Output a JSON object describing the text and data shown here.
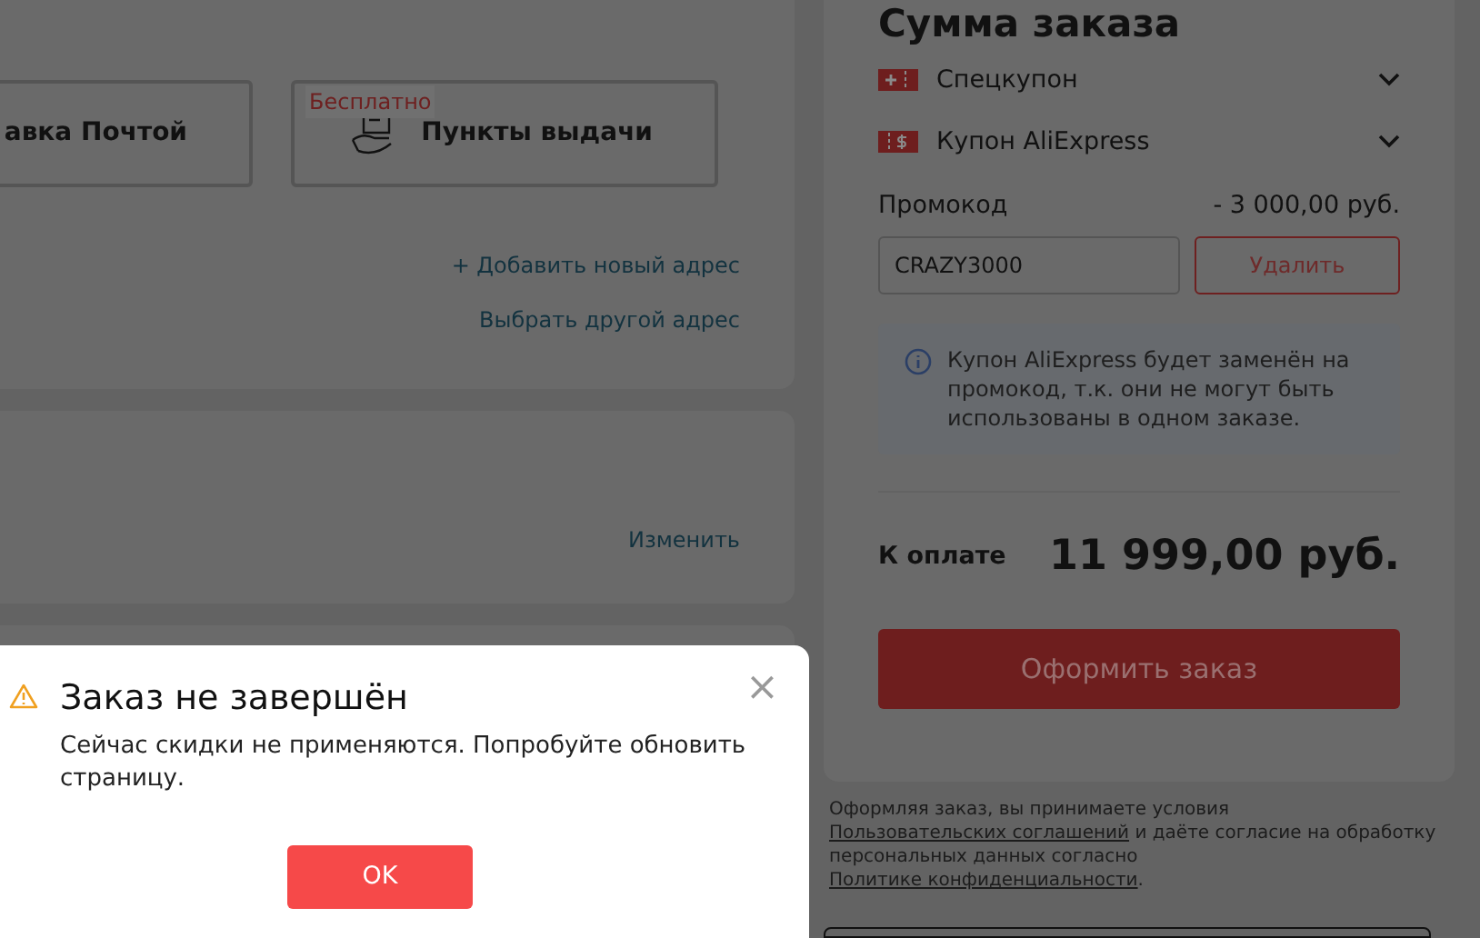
{
  "delivery_options": [
    {
      "label": "авка Почтой",
      "selected": false
    },
    {
      "label": "Пункты выдачи",
      "badge": "Бесплатно",
      "selected": false
    }
  ],
  "address_links": [
    "+ Добавить новый адрес",
    "Выбрать другой адрес"
  ],
  "second_card": {
    "link": "Изменить"
  },
  "summary": {
    "title": "Сумма заказа",
    "coupons": [
      {
        "label": "Спецкупон",
        "kind": "special",
        "expanded": false
      },
      {
        "label": "Купон AliExpress",
        "kind": "dollar",
        "expanded": false
      }
    ],
    "promo_label": "Промокод",
    "promo_discount": "- 3 000,00 руб.",
    "promo_value": "CRAZY3000",
    "remove_button": "Удалить",
    "notice": "Купон AliExpress будет заменён на промокод, т.к. они не могут быть использованы в одном заказе.",
    "total_label": "К оплате",
    "total": "11 999,00 руб.",
    "checkout_button": "Оформить заказ"
  },
  "legal": {
    "before": "Оформляя заказ, вы принимаете условия ",
    "link1": "Пользовательских соглашений",
    "middle": " и даёте согласие на обработку персональных данных согласно ",
    "link2": "Политике конфиденциальности",
    "after": "."
  },
  "dialog": {
    "title": "Заказ не завершён",
    "message": "Сейчас скидки не применяются. Попробуйте обновить страницу.",
    "close": "×",
    "ok_button": "OK"
  }
}
